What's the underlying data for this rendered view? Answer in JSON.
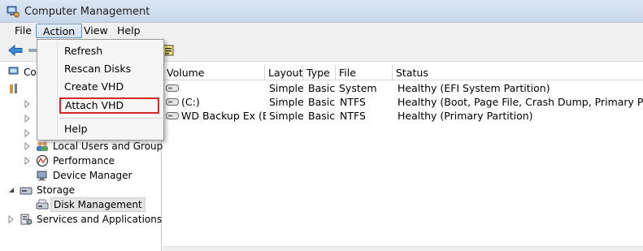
{
  "window": {
    "title": "Computer Management"
  },
  "menubar": {
    "items": [
      "File",
      "Action",
      "View",
      "Help"
    ]
  },
  "action_menu": {
    "items": [
      "Refresh",
      "Rescan Disks",
      "Create VHD",
      "Attach VHD",
      "Help"
    ],
    "highlighted": "Attach VHD"
  },
  "tree": {
    "root_partial": "Co",
    "items": [
      {
        "label": "Local Users and Groups",
        "icon": "users-icon",
        "expander": "collapsed"
      },
      {
        "label": "Performance",
        "icon": "performance-icon",
        "expander": "collapsed"
      },
      {
        "label": "Device Manager",
        "icon": "device-manager-icon",
        "expander": "none"
      },
      {
        "label": "Storage",
        "icon": "storage-icon",
        "expander": "expanded"
      },
      {
        "label": "Disk Management",
        "icon": "disk-management-icon",
        "expander": "none",
        "selected": true
      },
      {
        "label": "Services and Applications",
        "icon": "services-icon",
        "expander": "collapsed"
      }
    ]
  },
  "volumes": {
    "columns": [
      "Volume",
      "Layout",
      "Type",
      "File System",
      "Status"
    ],
    "rows": [
      [
        "",
        "Simple",
        "Basic",
        "",
        "Healthy (EFI System Partition)"
      ],
      [
        "(C:)",
        "Simple",
        "Basic",
        "NTFS",
        "Healthy (Boot, Page File, Crash Dump, Primary Partition)"
      ],
      [
        "WD Backup Ex  (E:)",
        "Simple",
        "Basic",
        "NTFS",
        "Healthy (Primary Partition)"
      ]
    ]
  },
  "colors": {
    "highlight_border": "#d7262a",
    "menu_active": "#d3e0f1"
  }
}
